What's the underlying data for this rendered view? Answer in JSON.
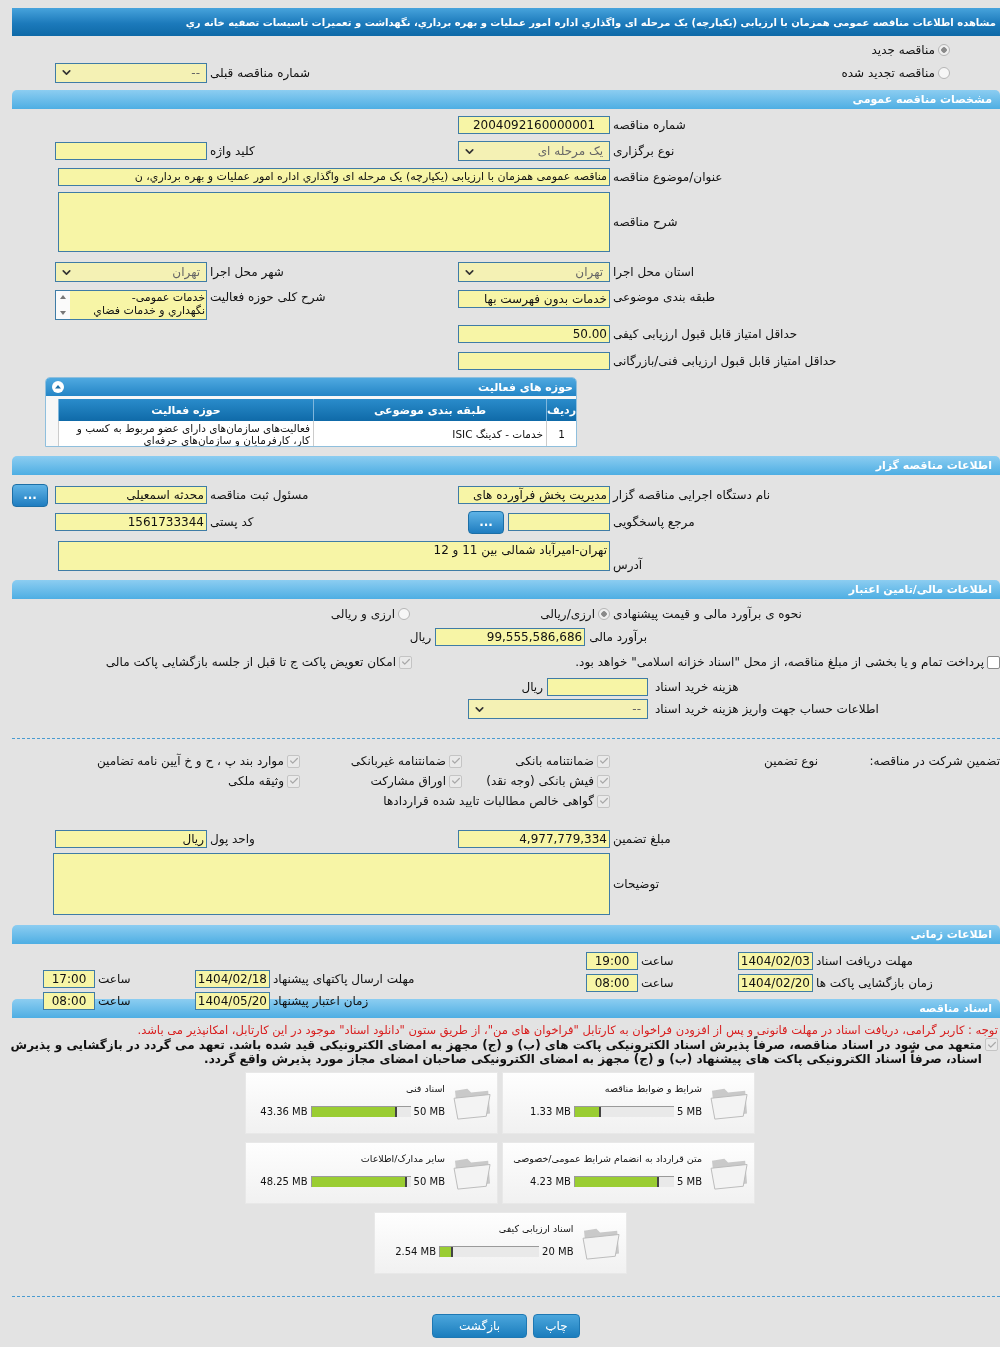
{
  "title": "مشاهده اطلاعات مناقصه عمومی همزمان با ارزیابی (یکپارچه) یک مرحله ای واگذاري اداره امور عملیات و بهره برداري، نگهداشت و تعمیرات تاسیسات تصفیه خانه ري",
  "tender_status": [
    {
      "label": "مناقصه جدید",
      "selected": true
    },
    {
      "label": "مناقصه تجدید شده",
      "selected": false
    }
  ],
  "previous_tender": {
    "label": "شماره مناقصه قبلی",
    "value": "--",
    "kind": "select"
  },
  "general": {
    "heading": "مشخصات مناقصه عمومی",
    "tender_number": {
      "label": "شماره مناقصه",
      "value": "2004092160000001",
      "kind": "text"
    },
    "keyword": {
      "label": "کلید واژه",
      "kind": "text"
    },
    "holding_type": {
      "label": "نوع برگزاری",
      "value": "یک مرحله ای",
      "kind": "select"
    },
    "subject": {
      "label": "عنوان/موضوع مناقصه",
      "value": "مناقصه عمومی همزمان با ارزیابی (یکپارچه) یک مرحله ای واگذاري اداره امور عملیات و بهره برداري، ن",
      "kind": "text"
    },
    "description": {
      "label": "شرح مناقصه",
      "kind": "textarea"
    },
    "province": {
      "label": "استان محل اجرا",
      "value": "تهران",
      "kind": "select"
    },
    "city": {
      "label": "شهر محل اجرا",
      "value": "تهران",
      "kind": "select"
    },
    "category": {
      "label": "طبقه بندی موضوعی",
      "value": "خدمات بدون فهرست بها",
      "kind": "text"
    },
    "activity_scope": {
      "label": "شرح کلی حوزه فعالیت",
      "value_lines": [
        "خدمات عمومی-",
        "نگهداري و خدمات فضاي"
      ]
    },
    "min_quality_score": {
      "label": "حداقل امتیاز قابل قبول ارزیابی کیفی",
      "value": "50.00",
      "kind": "text"
    },
    "min_technical_score": {
      "label": "حداقل امتیاز قابل قبول ارزیابی فنی/بازرگانی",
      "kind": "text"
    },
    "activity_table": {
      "title": "حوزه های فعالیت",
      "expanded": true,
      "columns": [
        "ردیف",
        "طبقه بندی موضوعی",
        "حوزه فعالیت"
      ],
      "rows": [
        [
          "1",
          "خدمات - کدینگ ISIC",
          "فعالیت‌های سازمان‌های دارای عضو مربوط به کسب و کار، کارفرمایان و سازمان‌های حرفه‌ای"
        ]
      ]
    }
  },
  "organizer": {
    "heading": "اطلاعات مناقصه گزار",
    "org_name": {
      "label": "نام دستگاه اجرایی مناقصه گزار",
      "value": "مدیریت پخش فرآورده های",
      "kind": "text"
    },
    "registrar": {
      "label": "مسئول ثبت مناقصه",
      "value": "محدثه اسمعیلی",
      "kind": "text",
      "button": "..."
    },
    "reference": {
      "label": "مرجع پاسخگویی",
      "kind": "text",
      "button": "..."
    },
    "postal_code": {
      "label": "کد پستی",
      "value": "1561733344",
      "kind": "text"
    },
    "address": {
      "label": "آدرس",
      "value": "تهران-امیرآباد شمالی بین 11 و 12",
      "kind": "textarea"
    }
  },
  "finance": {
    "heading": "اطلاعات مالی/تامین اعتبار",
    "estimate_method": {
      "label": "نحوه ی برآورد مالی و قیمت پیشنهادی",
      "options": [
        {
          "label": "ارزی/ریالی",
          "selected": true
        },
        {
          "label": "ارزی و ریالی",
          "selected": false
        }
      ]
    },
    "estimate": {
      "label": "برآورد مالی",
      "value": "99,555,586,686",
      "kind": "text",
      "unit": "ریال"
    },
    "treasury_bonds": {
      "label": "پرداخت تمام و یا بخشی از مبلغ مناقصه، از محل \"اسناد خزانه اسلامی\" خواهد بود.",
      "checked": false
    },
    "envelope_swap": {
      "label": "امکان تعویض پاکت ج تا قبل از جلسه بازگشایی پاکت مالی",
      "checked": true
    },
    "document_fee": {
      "label": "هزینه خرید اسناد",
      "kind": "text",
      "unit": "ریال"
    },
    "fee_account": {
      "label": "اطلاعات حساب جهت واریز هزینه خرید اسناد",
      "value": "--",
      "kind": "select"
    }
  },
  "guarantee": {
    "title": "تضمین شرکت در مناقصه:",
    "type_label": "نوع تضمین",
    "options": [
      {
        "label": "ضمانتنامه بانکی",
        "checked": true
      },
      {
        "label": "ضمانتنامه غیربانکی",
        "checked": true
      },
      {
        "label": "موارد بند پ ، ح و خ آیین نامه تضامین",
        "checked": true
      },
      {
        "label": "فیش بانکی (وجه نقد)",
        "checked": true
      },
      {
        "label": "اوراق مشارکت",
        "checked": true
      },
      {
        "label": "وثیقه ملکی",
        "checked": true
      },
      {
        "label": "گواهی خالص مطالبات تایید شده قراردادها",
        "checked": true
      }
    ],
    "amount": {
      "label": "مبلغ تضمین",
      "value": "4,977,779,334",
      "kind": "text"
    },
    "currency": {
      "label": "واحد پول",
      "value": "ریال",
      "kind": "text"
    },
    "notes": {
      "label": "توضیحات",
      "kind": "textarea"
    }
  },
  "schedule": {
    "heading": "اطلاعات زمانی",
    "items": [
      {
        "label": "مهلت دریافت اسناد",
        "date": "1404/02/03",
        "time_label": "ساعت",
        "time": "19:00"
      },
      {
        "label": "زمان بازگشایی پاکت ها",
        "date": "1404/02/20",
        "time_label": "ساعت",
        "time": "08:00"
      },
      {
        "label": "مهلت ارسال پاکتهای پیشنهاد",
        "date": "1404/02/18",
        "time_label": "ساعت",
        "time": "17:00"
      },
      {
        "label": "زمان اعتبار پیشنهاد",
        "date": "1404/05/20",
        "time_label": "ساعت",
        "time": "08:00"
      }
    ]
  },
  "documents": {
    "heading": "اسناد مناقصه",
    "notice": "توجه : کاربر گرامی، دریافت اسناد در مهلت قانونی و پس از افزودن فراخوان به کارتابل \"فراخوان های من\"، از طریق ستون \"دانلود اسناد\" موجود در این کارتابل، امکانپذیر می باشد.",
    "commitment": {
      "text": "متعهد می شود در اسناد مناقصه، صرفاً پذیرش اسناد الکترونیکی پاکت های (ب) و (ج) مجهز به امضای الکترونیکی قید شده باشد. تعهد می گردد در بازگشایی و پذیرش اسناد، صرفاً اسناد الکترونیکی پاکت های پیشنهاد (ب) و (ج) مجهز به امضای الکترونیکی صاحبان امضای مجاز مورد پذیرش واقع گردد.",
      "checked": true
    },
    "files": [
      {
        "name": "شرایط و ضوابط مناقصه",
        "size": "1.33 MB",
        "limit": "5 MB",
        "level": 0.266
      },
      {
        "name": "اسناد فنی",
        "size": "43.36 MB",
        "limit": "50 MB",
        "level": 0.867
      },
      {
        "name": "متن قرارداد به انضمام شرایط عمومی/خصوصی",
        "size": "4.23 MB",
        "limit": "5 MB",
        "level": 0.846
      },
      {
        "name": "سایر مدارک/اطلاعات",
        "size": "48.25 MB",
        "limit": "50 MB",
        "level": 0.965
      },
      {
        "name": "اسناد ارزیابی کیفی",
        "size": "2.54 MB",
        "limit": "20 MB",
        "level": 0.127
      }
    ]
  },
  "buttons": [
    {
      "label": "چاپ",
      "kind": "print"
    },
    {
      "label": "بازگشت",
      "kind": "back"
    }
  ]
}
